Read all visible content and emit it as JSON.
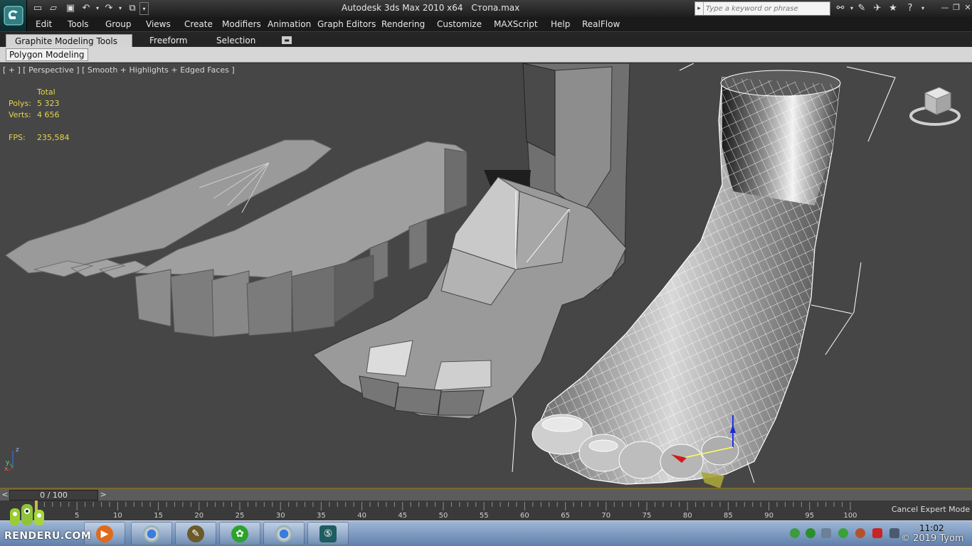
{
  "window": {
    "title": [
      "Autodesk 3ds Max  2010 x64",
      "Стопа.max"
    ],
    "search_placeholder": "Type a keyword or phrase"
  },
  "quick_access": [
    {
      "name": "new-file-icon"
    },
    {
      "name": "open-folder-icon"
    },
    {
      "name": "save-icon"
    },
    {
      "name": "undo-icon"
    },
    {
      "name": "redo-icon"
    },
    {
      "name": "project-folder-icon"
    }
  ],
  "menu": [
    "Edit",
    "Tools",
    "Group",
    "Views",
    "Create",
    "Modifiers",
    "Animation",
    "Graph Editors",
    "Rendering",
    "Customize",
    "MAXScript",
    "Help",
    "RealFlow"
  ],
  "ribbon": {
    "tabs": [
      "Graphite Modeling Tools",
      "Freeform",
      "Selection"
    ],
    "active_tab": "Graphite Modeling Tools",
    "panel_label": "Polygon Modeling"
  },
  "viewport": {
    "label": "[ + ] [ Perspective ] [ Smooth + Highlights + Edged Faces ]",
    "stats": {
      "header": "Total",
      "polys_label": "Polys:",
      "polys_value": "5 323",
      "verts_label": "Verts:",
      "verts_value": "4 656",
      "fps_label": "FPS:",
      "fps_value": "235,584"
    },
    "axis_labels": {
      "z": "z",
      "x": "x",
      "y": "y"
    }
  },
  "timeline": {
    "slider_text": "0 / 100",
    "ticks": [
      "5",
      "10",
      "15",
      "20",
      "25",
      "30",
      "35",
      "40",
      "45",
      "50",
      "55",
      "60",
      "65",
      "70",
      "75",
      "80",
      "85",
      "90",
      "95",
      "100"
    ],
    "current_frame": 0,
    "total_frames": 100
  },
  "status": {
    "cancel_expert_mode": "Cancel Expert Mode"
  },
  "taskbar": {
    "clock": "11:02",
    "apps": [
      "media-player-icon",
      "chrome-browser-icon",
      "pencil-editor-icon",
      "icq-icon",
      "chrome-browser-icon-2",
      "3dsmax-icon"
    ]
  },
  "watermark": {
    "brand": "RENDERU.COM",
    "copyright": "© 2019 Tyom"
  },
  "colors": {
    "viewport_bg": "#464646",
    "stats_text": "#e5d44a",
    "menubar_bg": "#1a1a1a",
    "ribbon_panel_bg": "#d6d6d6",
    "taskbar": "#7c98c2"
  }
}
